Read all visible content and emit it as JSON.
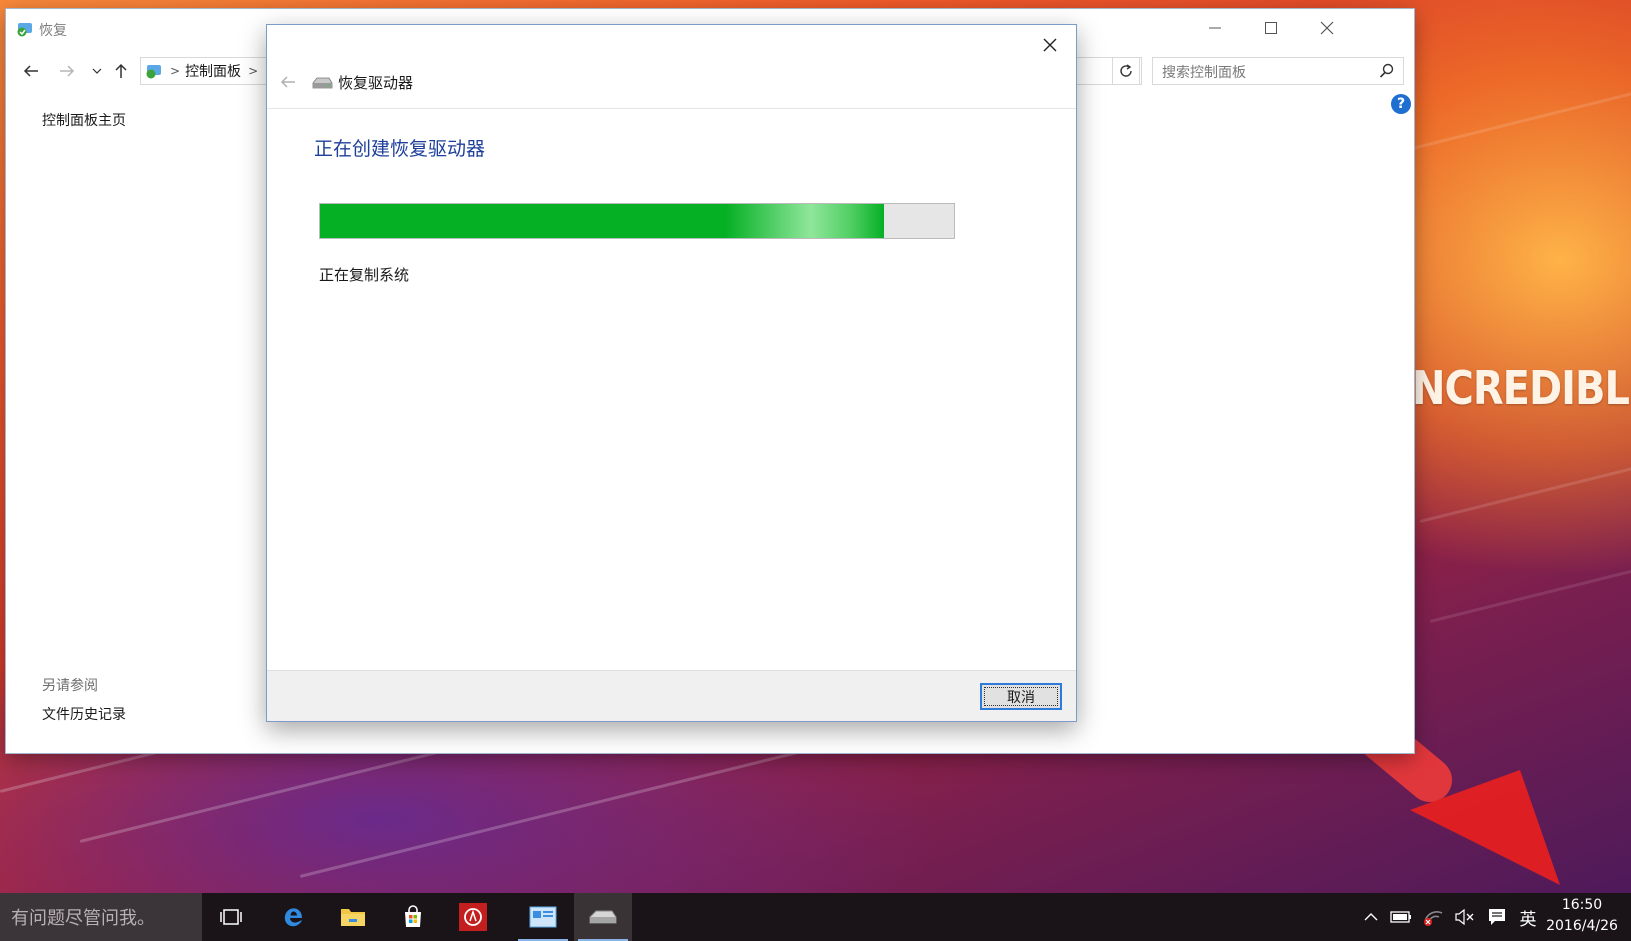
{
  "wallpaper": {
    "text": "NCREDIBLE"
  },
  "main_window": {
    "title": "恢复",
    "breadcrumb": [
      "控制面板"
    ],
    "search_placeholder": "搜索控制面板",
    "help_label": "?",
    "left_nav": {
      "home_link": "控制面板主页",
      "see_also_heading": "另请参阅",
      "see_also_links": [
        "文件历史记录"
      ]
    }
  },
  "dialog": {
    "title": "恢复驱动器",
    "heading": "正在创建恢复驱动器",
    "progress": 0.89,
    "status": "正在复制系统",
    "cancel_label": "取消"
  },
  "taskbar": {
    "search_placeholder": "有问题尽管问我。",
    "apps": [
      "task-view",
      "edge",
      "file-explorer",
      "store",
      "app-red",
      "control-panel",
      "recovery-drive"
    ],
    "tray": {
      "ime": "英",
      "time": "16:50",
      "date": "2016/4/26"
    }
  },
  "colors": {
    "progress_green": "#06b025",
    "heading_blue": "#1e3f9a",
    "annotation_arrow": "#ee2a2a",
    "taskbar": "#1a1418"
  }
}
